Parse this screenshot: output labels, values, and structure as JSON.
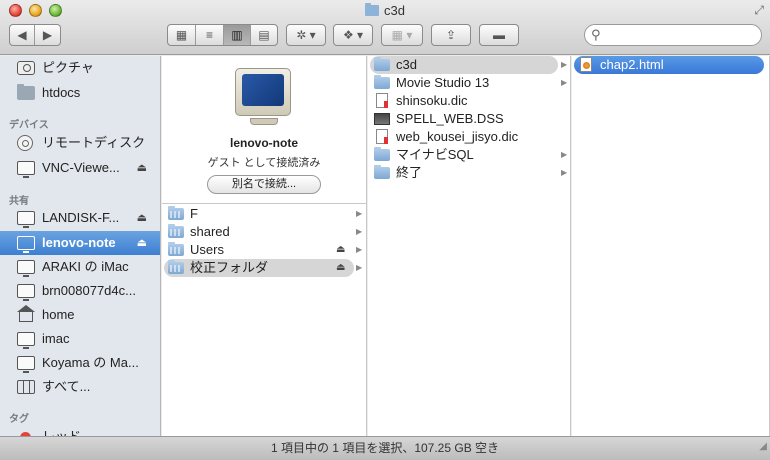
{
  "window": {
    "title": "c3d",
    "fullscreen_glyph": "⤢"
  },
  "toolbar": {
    "back_glyph": "◀",
    "forward_glyph": "▶",
    "view_icons": "▦",
    "view_list": "≡",
    "view_columns": "▥",
    "view_coverflow": "▤",
    "action_glyph": "✲ ▾",
    "dropbox_glyph": "❖ ▾",
    "arrange_glyph": "▦ ▾",
    "share_glyph": "⇪",
    "toggle_glyph": "▬",
    "search_value": ""
  },
  "sidebar": {
    "favorites": [
      {
        "label": "ピクチャ",
        "icon": "camera-icon"
      },
      {
        "label": "htdocs",
        "icon": "folder-icon"
      }
    ],
    "devices_heading": "デバイス",
    "devices": [
      {
        "label": "リモートディスク",
        "icon": "disc-icon"
      },
      {
        "label": "VNC-Viewe...",
        "icon": "monitor-icon",
        "eject": "⏏"
      }
    ],
    "shared_heading": "共有",
    "shared": [
      {
        "label": "LANDISK-F...",
        "icon": "monitor-icon",
        "eject": "⏏"
      },
      {
        "label": "lenovo-note",
        "icon": "monitor-icon",
        "eject": "⏏",
        "selected": true
      },
      {
        "label": "ARAKI の iMac",
        "icon": "monitor-icon"
      },
      {
        "label": "brn008077d4c...",
        "icon": "monitor-icon"
      },
      {
        "label": "home",
        "icon": "house-icon"
      },
      {
        "label": "imac",
        "icon": "monitor-icon"
      },
      {
        "label": "Koyama の Ma...",
        "icon": "monitor-icon"
      },
      {
        "label": "すべて...",
        "icon": "network-icon"
      }
    ],
    "tags_heading": "タグ",
    "tags": [
      {
        "label": "レッド",
        "color": "#e0443c"
      }
    ]
  },
  "column1": {
    "server_name": "lenovo-note",
    "server_status": "ゲスト として接続済み",
    "connect_as_label": "別名で接続...",
    "items": [
      {
        "label": "F",
        "has_children": true
      },
      {
        "label": "shared",
        "has_children": true
      },
      {
        "label": "Users",
        "has_children": true,
        "eject": "⏏"
      },
      {
        "label": "校正フォルダ",
        "has_children": true,
        "eject": "⏏",
        "highlighted": true
      }
    ]
  },
  "column2": {
    "items": [
      {
        "label": "c3d",
        "type": "folder",
        "has_children": true,
        "highlighted": true
      },
      {
        "label": "Movie Studio 13",
        "type": "folder",
        "has_children": true
      },
      {
        "label": "shinsoku.dic",
        "type": "dic"
      },
      {
        "label": "SPELL_WEB.DSS",
        "type": "dss"
      },
      {
        "label": "web_kousei_jisyo.dic",
        "type": "dic"
      },
      {
        "label": "マイナビSQL",
        "type": "folder",
        "has_children": true
      },
      {
        "label": "終了",
        "type": "folder",
        "has_children": true
      }
    ]
  },
  "column3": {
    "items": [
      {
        "label": "chap2.html",
        "type": "html",
        "selected": true
      }
    ]
  },
  "status_bar": {
    "text": "1 項目中の 1 項目を選択、107.25 GB 空き"
  },
  "colors": {
    "accent": "#3d7fd1",
    "sidebar_bg": "#e2e7ed",
    "selection_gray": "#d6d6d6"
  }
}
